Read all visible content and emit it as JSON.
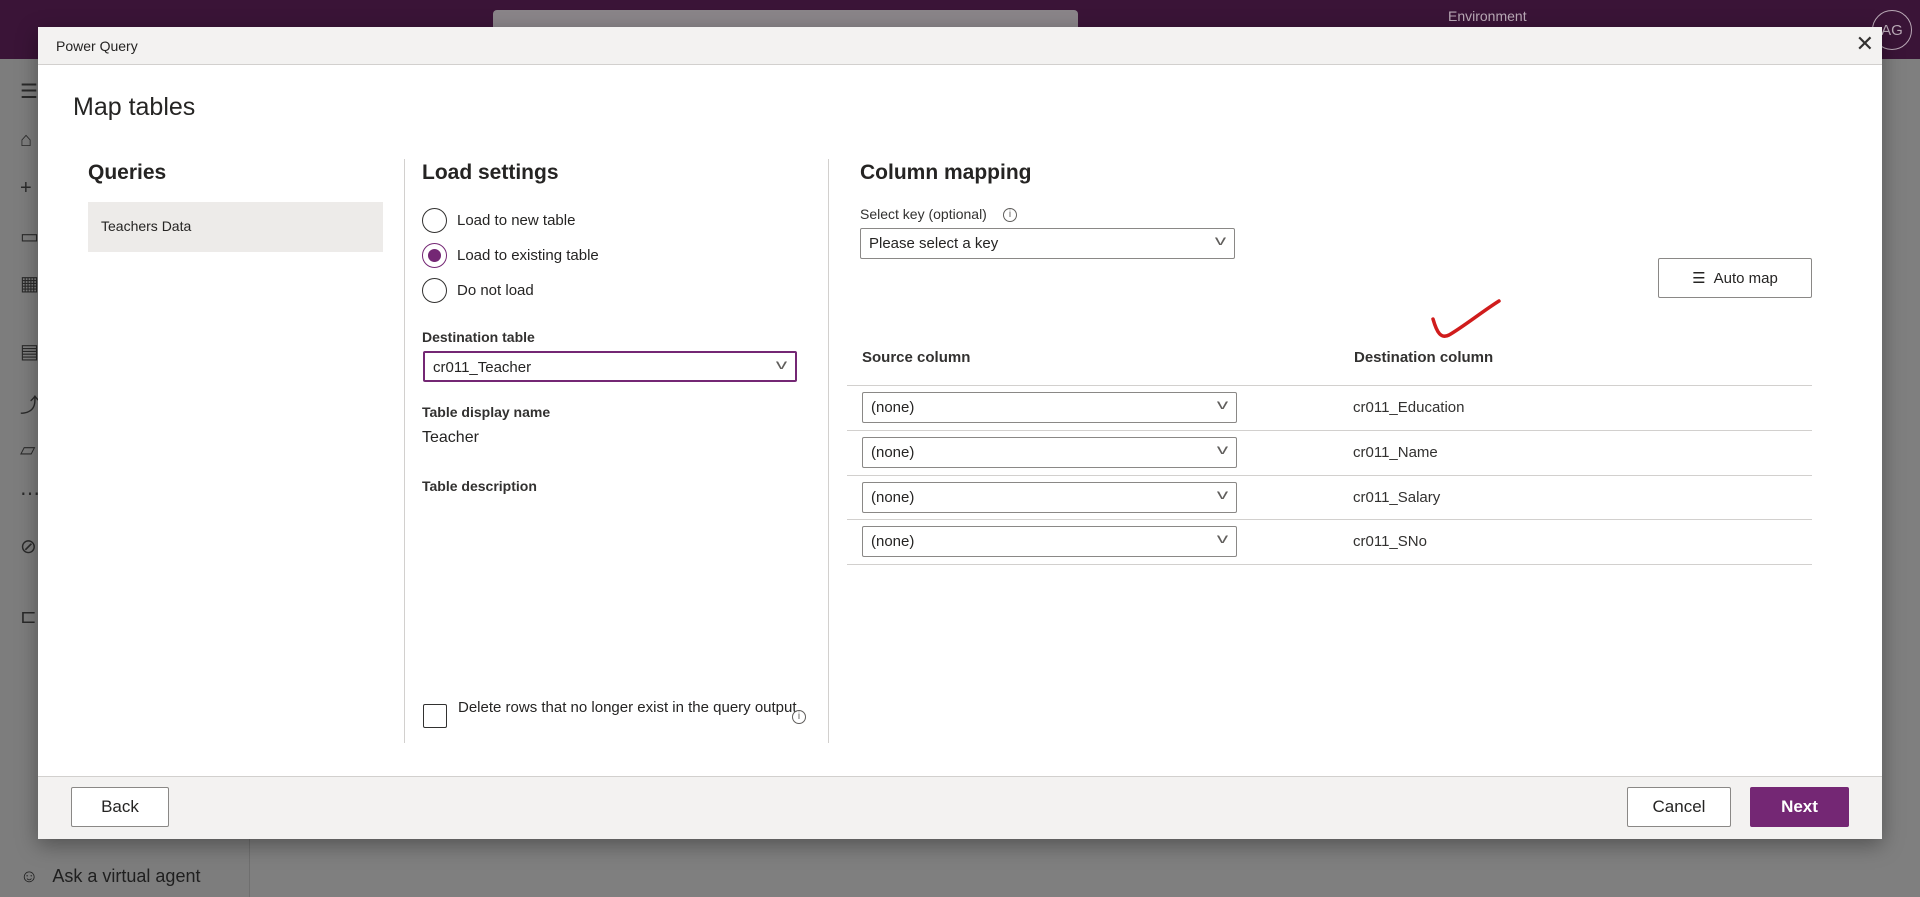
{
  "background": {
    "environment_label": "Environment",
    "avatar_initials": "AG",
    "ask_agent": "Ask a virtual agent"
  },
  "dialog": {
    "title": "Power Query",
    "heading": "Map tables",
    "queries": {
      "title": "Queries",
      "items": [
        "Teachers Data"
      ]
    },
    "load_settings": {
      "title": "Load settings",
      "options": [
        {
          "label": "Load to new table",
          "selected": false
        },
        {
          "label": "Load to existing table",
          "selected": true
        },
        {
          "label": "Do not load",
          "selected": false
        }
      ],
      "destination_label": "Destination table",
      "destination_value": "cr011_Teacher",
      "display_name_label": "Table display name",
      "display_name_value": "Teacher",
      "description_label": "Table description",
      "delete_rows_label": "Delete rows that no longer exist in the query output",
      "delete_rows_checked": false
    },
    "column_mapping": {
      "title": "Column mapping",
      "key_label": "Select key (optional)",
      "key_placeholder": "Please select a key",
      "auto_map": "Auto map",
      "source_header": "Source column",
      "destination_header": "Destination column",
      "rows": [
        {
          "source": "(none)",
          "destination": "cr011_Education"
        },
        {
          "source": "(none)",
          "destination": "cr011_Name"
        },
        {
          "source": "(none)",
          "destination": "cr011_Salary"
        },
        {
          "source": "(none)",
          "destination": "cr011_SNo"
        }
      ]
    },
    "footer": {
      "back": "Back",
      "cancel": "Cancel",
      "next": "Next"
    }
  },
  "colors": {
    "accent": "#742774",
    "topbar": "#3a1437",
    "annotation": "#d01c1c"
  }
}
